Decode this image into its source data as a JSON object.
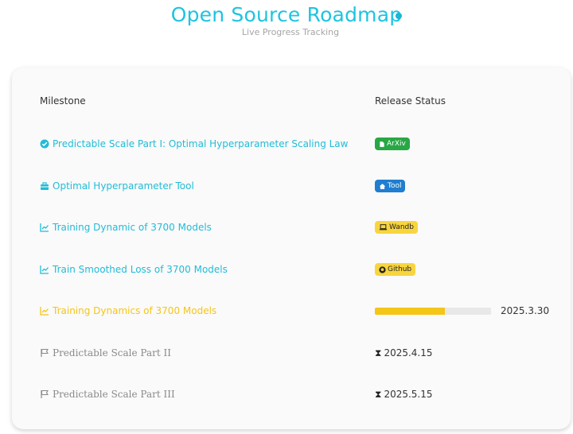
{
  "header": {
    "title": "Open Source Roadmap",
    "subtitle": "Live Progress Tracking",
    "accent_color": "#1ec4e0"
  },
  "table": {
    "columns": [
      "Milestone",
      "Release Status"
    ],
    "rows": [
      {
        "milestone": "Predictable Scale Part I: Optimal Hyperparameter Scaling Law",
        "icon": "check-circle-icon",
        "state": "done",
        "badge": "ArXiv",
        "badge_icon": "file-icon",
        "badge_color": "#28a745"
      },
      {
        "milestone": "Optimal Hyperparameter Tool",
        "icon": "toolbox-icon",
        "state": "done",
        "badge": "Tool",
        "badge_icon": "home-icon",
        "badge_color": "#1f7ecf"
      },
      {
        "milestone": "Training Dynamic of 3700 Models",
        "icon": "chart-line-icon",
        "state": "done",
        "badge": "Wandb",
        "badge_icon": "laptop-icon",
        "badge_color": "#f8d53f"
      },
      {
        "milestone": "Train Smoothed Loss of 3700 Models",
        "icon": "chart-line-icon",
        "state": "done",
        "badge": "Github",
        "badge_icon": "github-icon",
        "badge_color": "#f8d53f"
      },
      {
        "milestone": "Training Dynamics of 3700 Models",
        "icon": "chart-line-icon",
        "state": "in-progress",
        "progress": 0.6,
        "date": "2025.3.30"
      },
      {
        "milestone": "Predictable Scale Part II",
        "icon": "flag-icon",
        "state": "pending",
        "status_icon": "hourglass-icon",
        "date": "2025.4.15"
      },
      {
        "milestone": "Predictable Scale Part III",
        "icon": "flag-icon",
        "state": "pending",
        "status_icon": "hourglass-icon",
        "date": "2025.5.15"
      }
    ]
  }
}
